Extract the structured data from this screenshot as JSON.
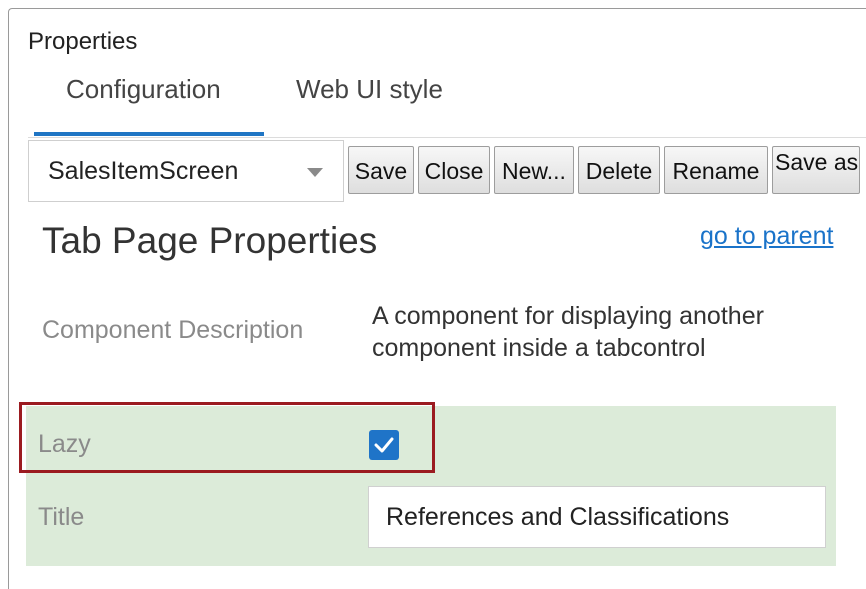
{
  "panel": {
    "title": "Properties"
  },
  "tabs": [
    {
      "label": "Configuration",
      "active": true
    },
    {
      "label": "Web UI style",
      "active": false
    }
  ],
  "toolbar": {
    "screen_select_value": "SalesItemScreen",
    "save_label": "Save",
    "close_label": "Close",
    "new_label": "New...",
    "delete_label": "Delete",
    "rename_label": "Rename",
    "save_as_label": "Save as"
  },
  "section": {
    "title": "Tab Page Properties",
    "parent_link": "go to parent"
  },
  "properties": {
    "component_description": {
      "label": "Component Description",
      "value": "A component for displaying another component inside a tabcontrol"
    },
    "lazy": {
      "label": "Lazy",
      "checked": true
    },
    "title": {
      "label": "Title",
      "value": "References and Classifications"
    }
  },
  "colors": {
    "accent": "#1f75c4",
    "link": "#1a73c9",
    "highlight_border": "#9b1b20",
    "row_background": "#dcebd9"
  },
  "icons": {
    "checkbox_check": "checkmark-icon",
    "select_caret": "chevron-down-icon"
  }
}
